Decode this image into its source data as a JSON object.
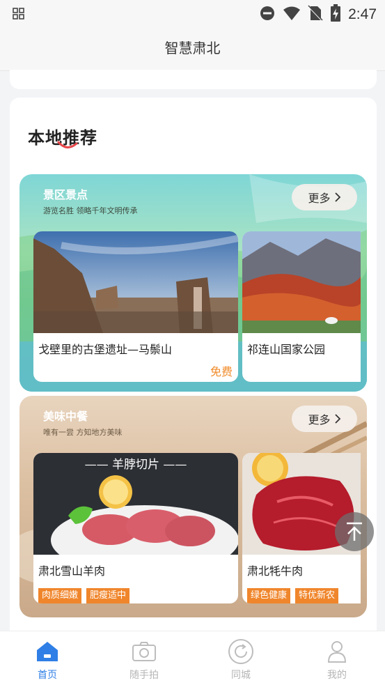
{
  "status_bar": {
    "time": "2:47",
    "icons": [
      "grid-app-icon",
      "dnd-icon",
      "wifi-icon",
      "no-sim-icon",
      "battery-charging-icon"
    ]
  },
  "header": {
    "title": "智慧肃北"
  },
  "section": {
    "title": "本地推荐"
  },
  "scenic": {
    "title": "景区景点",
    "subtitle": "游览名胜 领略千年文明传承",
    "more_label": "更多",
    "items": [
      {
        "name": "戈壁里的古堡遗址—马鬃山",
        "price": "免费"
      },
      {
        "name": "祁连山国家公园"
      }
    ]
  },
  "food": {
    "title": "美味中餐",
    "subtitle": "唯有一尝 方知地方美味",
    "more_label": "更多",
    "items": [
      {
        "name": "肃北雪山羊肉",
        "banner": "—— 羊脖切片 ——",
        "tags": [
          "肉质细嫩",
          "肥瘦适中"
        ]
      },
      {
        "name": "肃北牦牛肉",
        "tags": [
          "绿色健康",
          "特优新农"
        ]
      }
    ]
  },
  "bottom_nav": {
    "items": [
      {
        "label": "首页",
        "icon": "home-icon",
        "active": true
      },
      {
        "label": "随手拍",
        "icon": "camera-icon",
        "active": false
      },
      {
        "label": "同城",
        "icon": "refresh-circle-icon",
        "active": false
      },
      {
        "label": "我的",
        "icon": "user-icon",
        "active": false
      }
    ]
  },
  "colors": {
    "accent_blue": "#2f7fe6",
    "tag_orange": "#f0862c",
    "price_orange": "#f08b2a"
  }
}
